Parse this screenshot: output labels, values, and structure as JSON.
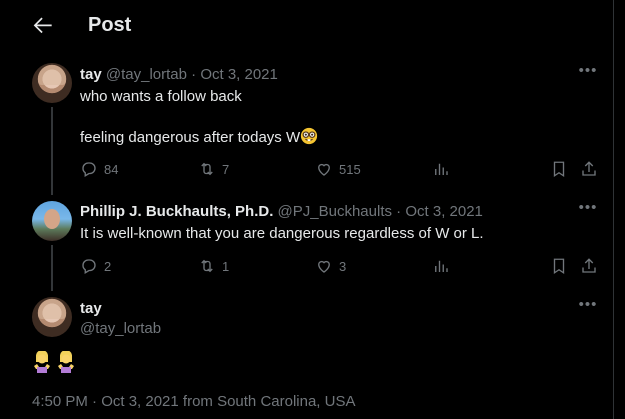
{
  "header": {
    "title": "Post"
  },
  "tweet1": {
    "name": "tay",
    "handle": "@tay_lortab",
    "sep": " · ",
    "date": "Oct 3, 2021",
    "line1": "who wants a follow back",
    "line2": "feeling dangerous after todays W",
    "emoji": "nerd-face-emoji",
    "replies": "84",
    "reposts": "7",
    "likes": "515"
  },
  "tweet2": {
    "name": "Phillip J. Buckhaults, Ph.D.",
    "handle": "@PJ_Buckhaults",
    "sep": " · ",
    "date": "Oct 3, 2021",
    "text": "It is well-known that you are dangerous regardless of W or L.",
    "replies": "2",
    "reposts": "1",
    "likes": "3"
  },
  "main": {
    "name": "tay",
    "handle": "@tay_lortab",
    "emojis": [
      "woman-shrugging-emoji",
      "woman-shrugging-emoji"
    ],
    "timestamp": "4:50 PM · Oct 3, 2021 from South Carolina, USA"
  },
  "colors": {
    "background": "#000000",
    "text": "#e7e9ea",
    "muted": "#71767b",
    "divider": "#2f3336"
  }
}
